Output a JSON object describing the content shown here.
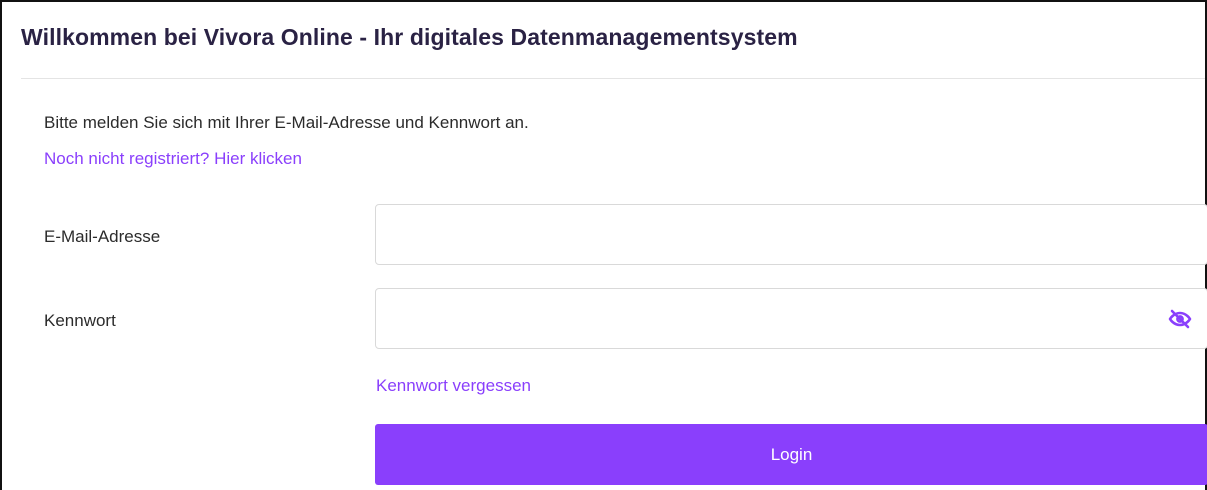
{
  "header": {
    "title": "Willkommen bei Vivora Online - Ihr digitales Datenmanagementsystem"
  },
  "intro": {
    "text": "Bitte melden Sie sich mit Ihrer E-Mail-Adresse und Kennwort an.",
    "register_link": "Noch nicht registriert? Hier klicken"
  },
  "form": {
    "email": {
      "label": "E-Mail-Adresse",
      "value": "",
      "placeholder": ""
    },
    "password": {
      "label": "Kennwort",
      "value": "",
      "placeholder": "",
      "toggle_icon": "eye-slash-icon"
    },
    "forgot_link": "Kennwort vergessen",
    "login_label": "Login"
  },
  "colors": {
    "accent": "#8a3ffc",
    "title": "#2a2244",
    "text": "#2b2b2b"
  }
}
